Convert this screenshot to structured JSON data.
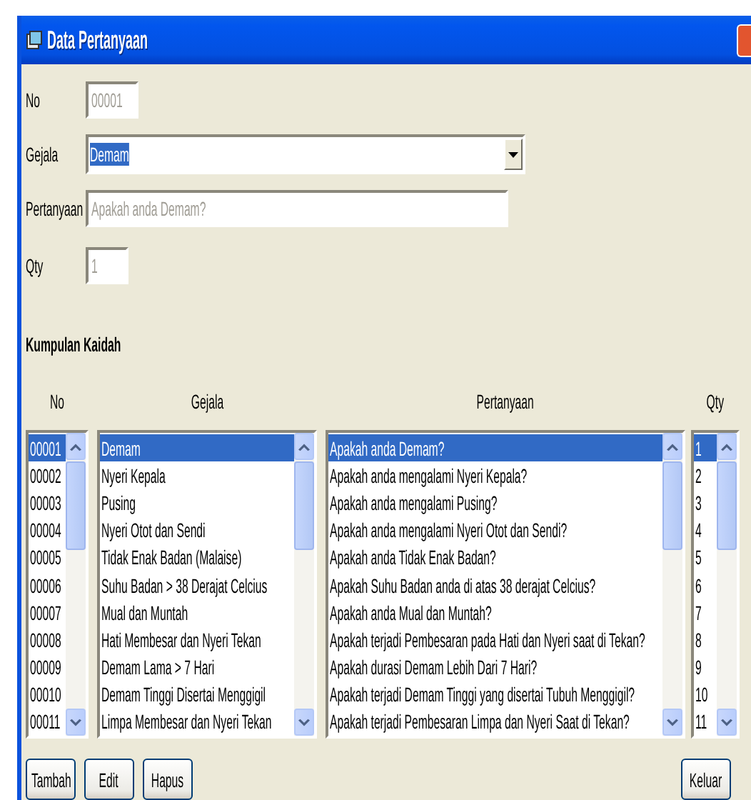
{
  "window": {
    "title": "Data Pertanyaan"
  },
  "form": [
    {
      "kind": "text",
      "label": "No",
      "value": "00001",
      "disabled": true
    },
    {
      "kind": "combo",
      "label": "Gejala",
      "value": "Demam",
      "disabled": false,
      "highlighted": true
    },
    {
      "kind": "text",
      "label": "Pertanyaan",
      "value": "Apakah anda Demam?",
      "disabled": true
    },
    {
      "kind": "text",
      "label": "Qty",
      "value": "1",
      "disabled": true
    }
  ],
  "kumpulan_kaidah": {
    "title": "Kumpulan Kaidah",
    "lists": [
      {
        "header": "No",
        "items": [
          {
            "text": "00001",
            "selected": true
          },
          {
            "text": "00002",
            "selected": false
          },
          {
            "text": "00003",
            "selected": false
          },
          {
            "text": "00004",
            "selected": false
          },
          {
            "text": "00005",
            "selected": false
          },
          {
            "text": "00006",
            "selected": false
          },
          {
            "text": "00007",
            "selected": false
          },
          {
            "text": "00008",
            "selected": false
          },
          {
            "text": "00009",
            "selected": false
          },
          {
            "text": "00010",
            "selected": false
          },
          {
            "text": "00011",
            "selected": false
          }
        ]
      },
      {
        "header": "Gejala",
        "items": [
          {
            "text": "Demam",
            "selected": true
          },
          {
            "text": "Nyeri Kepala",
            "selected": false
          },
          {
            "text": "Pusing",
            "selected": false
          },
          {
            "text": "Nyeri Otot dan Sendi",
            "selected": false
          },
          {
            "text": "Tidak Enak Badan (Malaise)",
            "selected": false
          },
          {
            "text": "Suhu Badan > 38 Derajat Celcius",
            "selected": false
          },
          {
            "text": "Mual dan Muntah",
            "selected": false
          },
          {
            "text": "Hati Membesar dan Nyeri Tekan",
            "selected": false
          },
          {
            "text": "Demam Lama > 7 Hari",
            "selected": false
          },
          {
            "text": "Demam Tinggi Disertai Menggigil",
            "selected": false
          },
          {
            "text": "Limpa Membesar dan Nyeri Tekan",
            "selected": false
          }
        ]
      },
      {
        "header": "Pertanyaan",
        "items": [
          {
            "text": "Apakah anda Demam?",
            "selected": true
          },
          {
            "text": "Apakah anda mengalami Nyeri Kepala?",
            "selected": false
          },
          {
            "text": "Apakah anda mengalami Pusing?",
            "selected": false
          },
          {
            "text": "Apakah anda mengalami Nyeri Otot dan Sendi?",
            "selected": false
          },
          {
            "text": "Apakah anda Tidak Enak Badan?",
            "selected": false
          },
          {
            "text": "Apakah Suhu Badan anda di atas 38 derajat Celcius?",
            "selected": false
          },
          {
            "text": "Apakah anda Mual dan Muntah?",
            "selected": false
          },
          {
            "text": "Apakah terjadi Pembesaran pada Hati dan Nyeri saat di Tekan?",
            "selected": false
          },
          {
            "text": "Apakah durasi Demam Lebih Dari 7 Hari?",
            "selected": false
          },
          {
            "text": "Apakah terjadi Demam Tinggi yang disertai Tubuh Menggigil?",
            "selected": false
          },
          {
            "text": "Apakah terjadi Pembesaran Limpa dan Nyeri Saat di Tekan?",
            "selected": false
          }
        ]
      },
      {
        "header": "Qty",
        "items": [
          {
            "text": "1",
            "selected": true
          },
          {
            "text": "2",
            "selected": false
          },
          {
            "text": "3",
            "selected": false
          },
          {
            "text": "4",
            "selected": false
          },
          {
            "text": "5",
            "selected": false
          },
          {
            "text": "6",
            "selected": false
          },
          {
            "text": "7",
            "selected": false
          },
          {
            "text": "8",
            "selected": false
          },
          {
            "text": "9",
            "selected": false
          },
          {
            "text": "10",
            "selected": false
          },
          {
            "text": "11",
            "selected": false
          }
        ]
      }
    ]
  },
  "buttons": [
    "Tambah",
    "Edit",
    "Hapus"
  ],
  "exit_button": "Keluar"
}
